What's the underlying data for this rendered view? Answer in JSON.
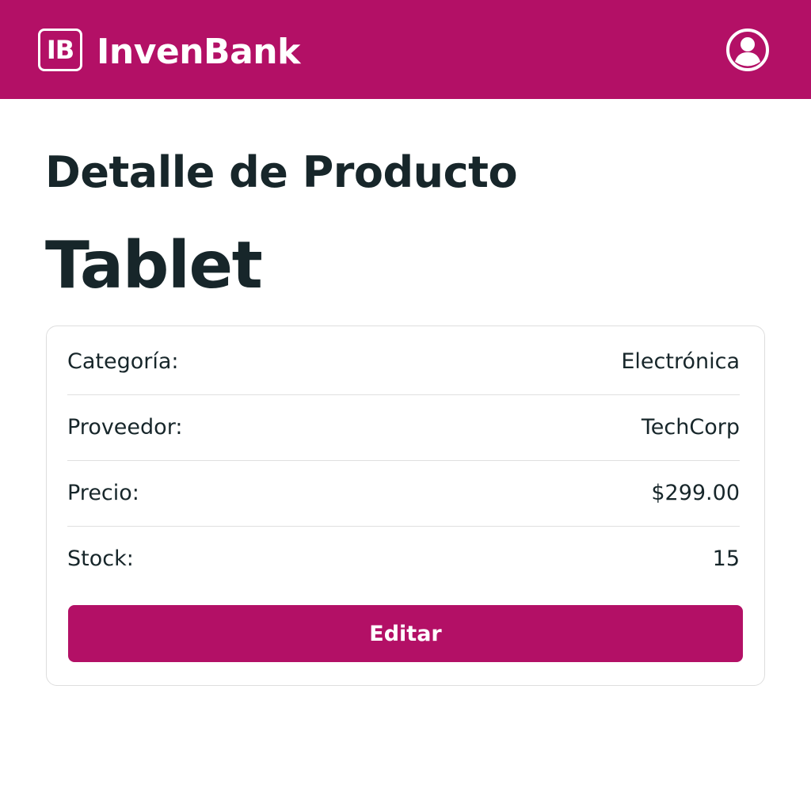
{
  "header": {
    "logo_text": "IB",
    "brand": "InvenBank",
    "user_icon": "user-circle-icon",
    "bg_color": "#b31066"
  },
  "page": {
    "heading": "Detalle de Producto",
    "product_name": "Tablet"
  },
  "details": [
    {
      "label": "Categoría:",
      "value": "Electrónica"
    },
    {
      "label": "Proveedor:",
      "value": "TechCorp"
    },
    {
      "label": "Precio:",
      "value": "$299.00"
    },
    {
      "label": "Stock:",
      "value": "15"
    }
  ],
  "actions": {
    "edit_label": "Editar",
    "accent_color": "#b31066"
  }
}
